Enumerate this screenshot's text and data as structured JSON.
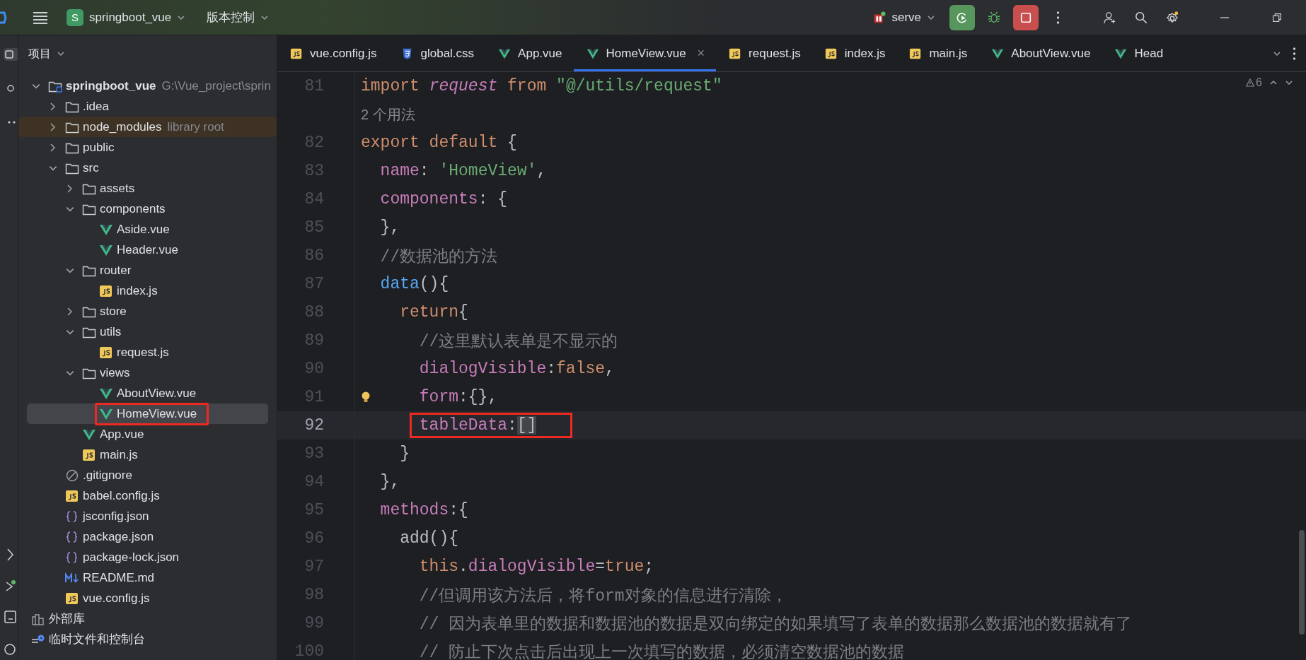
{
  "title_bar": {
    "project_badge": "S",
    "project": "springboot_vue",
    "vcs": "版本控制",
    "run_config": "serve"
  },
  "project_panel": {
    "title": "项目",
    "tree": [
      {
        "name": "springboot_vue",
        "kind": "project",
        "hint": "G:\\Vue_project\\sprin",
        "expanded": true,
        "selected": false,
        "tinted": false,
        "annotated": false,
        "children": [
          {
            "name": ".idea",
            "kind": "folder",
            "expanded": false,
            "selected": false,
            "tinted": false,
            "annotated": false
          },
          {
            "name": "node_modules",
            "kind": "folder",
            "hint": "library root",
            "expanded": false,
            "selected": false,
            "tinted": true,
            "annotated": false
          },
          {
            "name": "public",
            "kind": "folder",
            "expanded": false,
            "selected": false,
            "tinted": false,
            "annotated": false
          },
          {
            "name": "src",
            "kind": "folder",
            "expanded": true,
            "selected": false,
            "tinted": false,
            "annotated": false,
            "children": [
              {
                "name": "assets",
                "kind": "folder",
                "expanded": false,
                "selected": false,
                "tinted": false,
                "annotated": false
              },
              {
                "name": "components",
                "kind": "folder",
                "expanded": true,
                "selected": false,
                "tinted": false,
                "annotated": false,
                "children": [
                  {
                    "name": "Aside.vue",
                    "kind": "vue",
                    "selected": false,
                    "tinted": false,
                    "annotated": false
                  },
                  {
                    "name": "Header.vue",
                    "kind": "vue",
                    "selected": false,
                    "tinted": false,
                    "annotated": false
                  }
                ]
              },
              {
                "name": "router",
                "kind": "folder",
                "expanded": true,
                "selected": false,
                "tinted": false,
                "annotated": false,
                "children": [
                  {
                    "name": "index.js",
                    "kind": "js",
                    "selected": false,
                    "tinted": false,
                    "annotated": false
                  }
                ]
              },
              {
                "name": "store",
                "kind": "folder",
                "expanded": false,
                "selected": false,
                "tinted": false,
                "annotated": false
              },
              {
                "name": "utils",
                "kind": "folder",
                "expanded": true,
                "selected": false,
                "tinted": false,
                "annotated": false,
                "children": [
                  {
                    "name": "request.js",
                    "kind": "js",
                    "selected": false,
                    "tinted": false,
                    "annotated": false
                  }
                ]
              },
              {
                "name": "views",
                "kind": "folder",
                "expanded": true,
                "selected": false,
                "tinted": false,
                "annotated": false,
                "children": [
                  {
                    "name": "AboutView.vue",
                    "kind": "vue",
                    "selected": false,
                    "tinted": false,
                    "annotated": false
                  },
                  {
                    "name": "HomeView.vue",
                    "kind": "vue",
                    "selected": true,
                    "tinted": false,
                    "annotated": true
                  }
                ]
              },
              {
                "name": "App.vue",
                "kind": "vue",
                "selected": false,
                "tinted": false,
                "annotated": false
              },
              {
                "name": "main.js",
                "kind": "js",
                "selected": false,
                "tinted": false,
                "annotated": false
              }
            ]
          },
          {
            "name": ".gitignore",
            "kind": "ignore",
            "selected": false,
            "tinted": false,
            "annotated": false
          },
          {
            "name": "babel.config.js",
            "kind": "js",
            "selected": false,
            "tinted": false,
            "annotated": false
          },
          {
            "name": "jsconfig.json",
            "kind": "json",
            "selected": false,
            "tinted": false,
            "annotated": false
          },
          {
            "name": "package.json",
            "kind": "json",
            "selected": false,
            "tinted": false,
            "annotated": false
          },
          {
            "name": "package-lock.json",
            "kind": "json",
            "selected": false,
            "tinted": false,
            "annotated": false
          },
          {
            "name": "README.md",
            "kind": "md",
            "selected": false,
            "tinted": false,
            "annotated": false
          },
          {
            "name": "vue.config.js",
            "kind": "js",
            "selected": false,
            "tinted": false,
            "annotated": false
          }
        ]
      },
      {
        "name": "外部库",
        "kind": "library",
        "selected": false,
        "tinted": false,
        "annotated": false
      },
      {
        "name": "临时文件和控制台",
        "kind": "scratch",
        "selected": false,
        "tinted": false,
        "annotated": false
      }
    ]
  },
  "editor": {
    "tabs": [
      {
        "label": "vue.config.js",
        "kind": "js",
        "selected": false
      },
      {
        "label": "global.css",
        "kind": "css",
        "selected": false
      },
      {
        "label": "App.vue",
        "kind": "vue",
        "selected": false
      },
      {
        "label": "HomeView.vue",
        "kind": "vue",
        "selected": true,
        "close": "×"
      },
      {
        "label": "request.js",
        "kind": "js",
        "selected": false
      },
      {
        "label": "index.js",
        "kind": "js",
        "selected": false
      },
      {
        "label": "main.js",
        "kind": "js",
        "selected": false
      },
      {
        "label": "AboutView.vue",
        "kind": "vue",
        "selected": false
      },
      {
        "label": "Head",
        "kind": "vue",
        "selected": false
      }
    ],
    "inspection_count": "6",
    "lines": [
      {
        "kind": "code",
        "number": "81",
        "current": false,
        "annotated": false,
        "bulb": false,
        "tokens": [
          {
            "kind": "keyword",
            "text": "import "
          },
          {
            "kind": "italic",
            "text": "request"
          },
          {
            "kind": "keyword",
            "text": " from "
          },
          {
            "kind": "string",
            "text": "\"@/utils/request\""
          }
        ]
      },
      {
        "kind": "inlay",
        "text": "2 个用法"
      },
      {
        "kind": "code",
        "number": "82",
        "current": false,
        "annotated": false,
        "bulb": false,
        "tokens": [
          {
            "kind": "keyword",
            "text": "export default "
          },
          {
            "kind": "punct",
            "text": "{"
          }
        ],
        "children": [
          {
            "kind": "code",
            "number": "83",
            "current": false,
            "annotated": false,
            "bulb": false,
            "tokens": [
              {
                "kind": "prop",
                "text": "name"
              },
              {
                "kind": "punct",
                "text": ": "
              },
              {
                "kind": "string",
                "text": "'HomeView'"
              },
              {
                "kind": "punct",
                "text": ","
              }
            ]
          },
          {
            "kind": "code",
            "number": "84",
            "current": false,
            "annotated": false,
            "bulb": false,
            "tokens": [
              {
                "kind": "prop",
                "text": "components"
              },
              {
                "kind": "punct",
                "text": ": {"
              }
            ]
          },
          {
            "kind": "code",
            "number": "85",
            "current": false,
            "annotated": false,
            "bulb": false,
            "tokens": [
              {
                "kind": "punct",
                "text": "},"
              }
            ]
          },
          {
            "kind": "code",
            "number": "86",
            "current": false,
            "annotated": false,
            "bulb": false,
            "tokens": [
              {
                "kind": "comment",
                "text": "//数据池的方法"
              }
            ]
          },
          {
            "kind": "code",
            "number": "87",
            "current": false,
            "annotated": false,
            "bulb": false,
            "tokens": [
              {
                "kind": "function",
                "text": "data"
              },
              {
                "kind": "punct",
                "text": "(){"
              }
            ],
            "children": [
              {
                "kind": "code",
                "number": "88",
                "current": false,
                "annotated": false,
                "bulb": false,
                "tokens": [
                  {
                    "kind": "keyword",
                    "text": "return"
                  },
                  {
                    "kind": "punct",
                    "text": "{"
                  }
                ],
                "children": [
                  {
                    "kind": "code",
                    "number": "89",
                    "current": false,
                    "annotated": false,
                    "bulb": false,
                    "tokens": [
                      {
                        "kind": "comment",
                        "text": "//这里默认表单是不显示的"
                      }
                    ]
                  },
                  {
                    "kind": "code",
                    "number": "90",
                    "current": false,
                    "annotated": false,
                    "bulb": false,
                    "tokens": [
                      {
                        "kind": "prop",
                        "text": "dialogVisible"
                      },
                      {
                        "kind": "punct",
                        "text": ":"
                      },
                      {
                        "kind": "keyword",
                        "text": "false"
                      },
                      {
                        "kind": "punct",
                        "text": ","
                      }
                    ]
                  },
                  {
                    "kind": "code",
                    "number": "91",
                    "current": false,
                    "annotated": false,
                    "bulb": true,
                    "tokens": [
                      {
                        "kind": "prop",
                        "text": "form"
                      },
                      {
                        "kind": "punct",
                        "text": ":{},"
                      }
                    ]
                  },
                  {
                    "kind": "code",
                    "number": "92",
                    "current": true,
                    "annotated": true,
                    "bulb": false,
                    "tokens": [
                      {
                        "kind": "prop",
                        "text": "tableData"
                      },
                      {
                        "kind": "punct",
                        "text": ":"
                      },
                      {
                        "kind": "match",
                        "text": "[]"
                      }
                    ]
                  }
                ]
              },
              {
                "kind": "code",
                "number": "93",
                "current": false,
                "annotated": false,
                "bulb": false,
                "tokens": [
                  {
                    "kind": "punct",
                    "text": "}"
                  }
                ]
              }
            ]
          },
          {
            "kind": "code",
            "number": "94",
            "current": false,
            "annotated": false,
            "bulb": false,
            "tokens": [
              {
                "kind": "punct",
                "text": "},"
              }
            ]
          },
          {
            "kind": "code",
            "number": "95",
            "current": false,
            "annotated": false,
            "bulb": false,
            "tokens": [
              {
                "kind": "prop",
                "text": "methods"
              },
              {
                "kind": "punct",
                "text": ":{"
              }
            ],
            "children": [
              {
                "kind": "code",
                "number": "96",
                "current": false,
                "annotated": false,
                "bulb": false,
                "tokens": [
                  {
                    "kind": "plain",
                    "text": "add"
                  },
                  {
                    "kind": "punct",
                    "text": "(){"
                  }
                ],
                "children": [
                  {
                    "kind": "code",
                    "number": "97",
                    "current": false,
                    "annotated": false,
                    "bulb": false,
                    "tokens": [
                      {
                        "kind": "keyword",
                        "text": "this"
                      },
                      {
                        "kind": "punct",
                        "text": "."
                      },
                      {
                        "kind": "prop",
                        "text": "dialogVisible"
                      },
                      {
                        "kind": "punct",
                        "text": "="
                      },
                      {
                        "kind": "keyword",
                        "text": "true"
                      },
                      {
                        "kind": "punct",
                        "text": ";"
                      }
                    ]
                  },
                  {
                    "kind": "code",
                    "number": "98",
                    "current": false,
                    "annotated": false,
                    "bulb": false,
                    "tokens": [
                      {
                        "kind": "comment",
                        "text": "//但调用该方法后，将form对象的信息进行清除，"
                      }
                    ]
                  },
                  {
                    "kind": "code",
                    "number": "99",
                    "current": false,
                    "annotated": false,
                    "bulb": false,
                    "tokens": [
                      {
                        "kind": "comment",
                        "text": "// 因为表单里的数据和数据池的数据是双向绑定的如果填写了表单的数据那么数据池的数据就有了"
                      }
                    ]
                  },
                  {
                    "kind": "code",
                    "number": "100",
                    "current": false,
                    "annotated": false,
                    "bulb": false,
                    "tokens": [
                      {
                        "kind": "comment",
                        "text": "// 防止下次点击后出现上一次填写的数据，必须清空数据池的数据"
                      }
                    ]
                  }
                ]
              }
            ]
          }
        ]
      }
    ]
  }
}
